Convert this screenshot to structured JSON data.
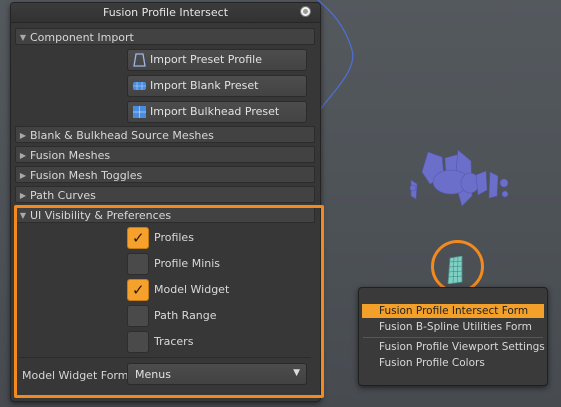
{
  "window": {
    "title": "Fusion Profile Intersect"
  },
  "component_import": {
    "header": "Component Import",
    "buttons": [
      {
        "label": "Import Preset Profile",
        "icon": "profile-shape-icon"
      },
      {
        "label": "Import Blank Preset",
        "icon": "blank-preset-grid-icon"
      },
      {
        "label": "Import Bulkhead Preset",
        "icon": "bulkhead-grid-icon"
      }
    ]
  },
  "collapsed_sections": [
    "Blank & Bulkhead Source Meshes",
    "Fusion Meshes",
    "Fusion Mesh Toggles",
    "Path Curves"
  ],
  "ui_visibility": {
    "header": "UI Visibility & Preferences",
    "checkboxes": [
      {
        "label": "Profiles",
        "checked": true
      },
      {
        "label": "Profile Minis",
        "checked": false
      },
      {
        "label": "Model Widget",
        "checked": true
      },
      {
        "label": "Path Range",
        "checked": false
      },
      {
        "label": "Tracers",
        "checked": false
      }
    ],
    "model_widget_forms": {
      "label": "Model Widget Forms:",
      "value": "Menus"
    }
  },
  "popup_menu": {
    "items": [
      {
        "label": "Fusion Profile Intersect Form",
        "active": true
      },
      {
        "label": "Fusion B-Spline Utilities Form",
        "active": false
      },
      {
        "label": "Fusion Profile Viewport Settings",
        "active": false
      },
      {
        "label": "Fusion Profile Colors",
        "active": false
      }
    ]
  },
  "colors": {
    "highlight": "#f28a1e",
    "checkbox_on": "#f5a12c",
    "menu_active": "#f3a02a",
    "model": "#6b6fc9",
    "curve": "#4f6fd8"
  }
}
